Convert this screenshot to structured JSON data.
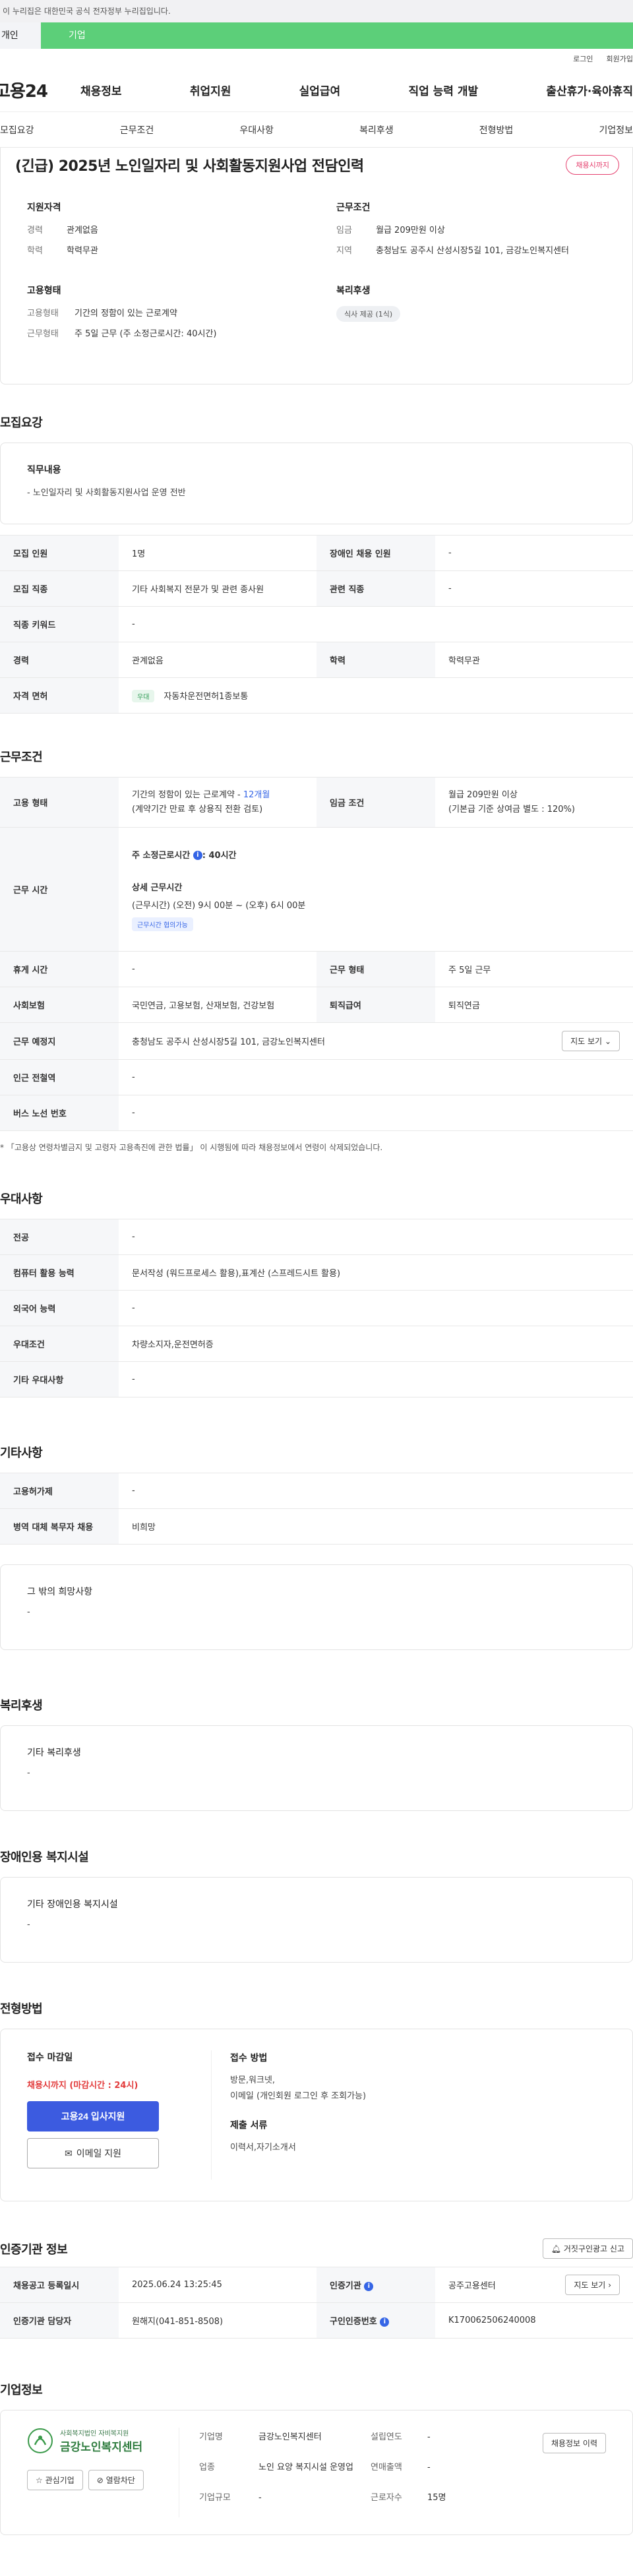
{
  "gov_banner": "이 누리집은 대한민국 공식 전자정부 누리집입니다.",
  "top_tabs": [
    "개인",
    "기업"
  ],
  "util_links": [
    "로그인",
    "회원가입"
  ],
  "logo": "고용24",
  "gnb": [
    "채용정보",
    "취업지원",
    "실업급여",
    "직업 능력 개발",
    "출산휴가·육아휴직"
  ],
  "subnav": [
    "모집요강",
    "근무조건",
    "우대사항",
    "복리후생",
    "전형방법",
    "기업정보"
  ],
  "header": {
    "title": "(긴급) 2025년 노인일자리 및 사회활동지원사업 전담인력",
    "status_badge": "채용시까지",
    "qualification_title": "지원자격",
    "qual": [
      {
        "k": "경력",
        "v": "관계없음"
      },
      {
        "k": "학력",
        "v": "학력무관"
      }
    ],
    "employment_title": "고용형태",
    "emp": [
      {
        "k": "고용형태",
        "v": "기간의 정함이 있는 근로계약"
      },
      {
        "k": "근무형태",
        "v": "주 5일 근무 (주 소정근로시간: 40시간)"
      }
    ],
    "conditions_title": "근무조건",
    "cond": [
      {
        "k": "임금",
        "v": "월급 209만원 이상"
      },
      {
        "k": "지역",
        "v": "충청남도 공주시 산성시장5길 101, 금강노인복지센터"
      }
    ],
    "welfare_title": "복리후생",
    "welfare_chip": "식사 제공 (1식)"
  },
  "recruit": {
    "section": "모집요강",
    "duty_title": "직무내용",
    "duty_text": "- 노인일자리 및 사회활동지원사업 운영 전반",
    "rows": {
      "r1": {
        "k1": "모집 인원",
        "v1": "1명",
        "k2": "장애인 채용 인원",
        "v2": "-"
      },
      "r2": {
        "k1": "모집 직종",
        "v1": "기타 사회복지 전문가 및 관련 종사원",
        "k2": "관련 직종",
        "v2": "-"
      },
      "r3": {
        "k1": "직종 키워드",
        "v1": "-"
      },
      "r4": {
        "k1": "경력",
        "v1": "관계없음",
        "k2": "학력",
        "v2": "학력무관"
      },
      "r5": {
        "k1": "자격 면허",
        "tag": "우대",
        "v1": "자동차운전면허1종보통"
      }
    }
  },
  "work": {
    "section": "근무조건",
    "emp_k": "고용 형태",
    "emp_v1": "기간의 정함이 있는 근로계약 - ",
    "emp_v1b": "12개월",
    "emp_v2": "(계약기간 만료 후 상용직 전환 검토)",
    "wage_k": "임금 조건",
    "wage_v1": "월급 209만원 이상",
    "wage_v2": "(기본급 기준 상여금 별도 : 120%)",
    "hours_k": "근무 시간",
    "hours_title": "주 소정근로시간",
    "hours_value": ": 40시간",
    "detail_title": "상세 근무시간",
    "detail_text": "(근무시간) (오전) 9시 00분 ~ (오후) 6시 00분",
    "detail_tag": "근무시간 협의가능",
    "rest_k": "휴게 시간",
    "rest_v": "-",
    "form_k": "근무 형태",
    "form_v": "주 5일 근무",
    "insure_k": "사회보험",
    "insure_v": "국민연금, 고용보험, 산재보험, 건강보험",
    "retire_k": "퇴직급여",
    "retire_v": "퇴직연금",
    "place_k": "근무 예정지",
    "place_v": "충청남도 공주시 산성시장5길 101, 금강노인복지센터",
    "map_btn": "지도 보기",
    "station_k": "인근 전철역",
    "station_v": "-",
    "bus_k": "버스 노선 번호",
    "bus_v": "-",
    "note": "* 「고용상 연령차별금지 및 고령자 고용촉진에 관한 법률」 이 시행됨에 따라 채용정보에서 연령이 삭제되었습니다."
  },
  "pref": {
    "section": "우대사항",
    "rows": [
      {
        "k": "전공",
        "v": "-"
      },
      {
        "k": "컴퓨터 활용 능력",
        "v": "문서작성 (워드프로세스 활용),표계산 (스프레드시트 활용)"
      },
      {
        "k": "외국어 능력",
        "v": "-"
      },
      {
        "k": "우대조건",
        "v": "차량소지자,운전면허증"
      },
      {
        "k": "기타 우대사항",
        "v": "-"
      }
    ]
  },
  "etc": {
    "section": "기타사항",
    "rows": [
      {
        "k": "고용허가제",
        "v": "-"
      },
      {
        "k": "병역 대체 복무자 채용",
        "v": "비희망"
      }
    ],
    "card_title": "그 밖의 희망사항",
    "card_text": "-"
  },
  "welfare": {
    "section": "복리후생",
    "card_title": "기타 복리후생",
    "card_text": "-"
  },
  "disabled": {
    "section": "장애인용 복지시설",
    "card_title": "기타 장애인용 복지시설",
    "card_text": "-"
  },
  "selection": {
    "section": "전형방법",
    "deadline_title": "접수 마감일",
    "deadline_value": "채용시까지 (마감시간 : 24시)",
    "apply_btn": "고용24 입사지원",
    "email_btn": "이메일 지원",
    "method_title": "접수 방법",
    "method_text1": "방문,워크넷,",
    "method_text2": "이메일 (개인회원 로그인 후 조회가능)",
    "docs_title": "제출 서류",
    "docs_text": "이력서,자기소개서"
  },
  "agency": {
    "section": "인증기관 정보",
    "report_btn": "거짓구인광고 신고",
    "r1": {
      "k1": "채용공고 등록일시",
      "v1": "2025.06.24 13:25:45",
      "k2": "인증기관",
      "v2": "공주고용센터",
      "btn": "지도 보기"
    },
    "r2": {
      "k1": "인증기관 담당자",
      "v1": "원해지(041-851-8508)",
      "k2": "구인인증번호",
      "v2": "K170062506240008"
    }
  },
  "company": {
    "section": "기업정보",
    "logo_top": "사회복지법인 자비복지원",
    "logo_name": "금강노인복지센터",
    "fav_btn": "관심기업",
    "block_btn": "열람차단",
    "name_k": "기업명",
    "name_v": "금강노인복지센터",
    "biz_k": "업종",
    "biz_v": "노인 요양 복지시설 운영업",
    "size_k": "기업규모",
    "size_v": "-",
    "year_k": "설립연도",
    "year_v": "-",
    "sales_k": "연매출액",
    "sales_v": "-",
    "emp_k": "근로자수",
    "emp_v": "15명",
    "more_btn": "채용정보 이력"
  }
}
